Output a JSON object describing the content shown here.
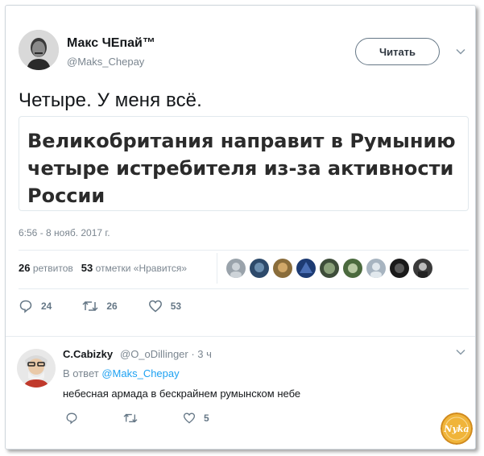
{
  "tweet": {
    "author_name": "Макс ЧЕпай™",
    "author_handle": "@Maks_Chepay",
    "follow_label": "Читать",
    "text": "Четыре. У меня всё.",
    "quote_headline": "Великобритания направит в Румынию четыре истребителя из-за активности России",
    "timestamp": "6:56 - 8 нояб. 2017 г."
  },
  "stats": {
    "retweets_count": "26",
    "retweets_label": "ретвитов",
    "likes_count": "53",
    "likes_label": "отметки «Нравится»"
  },
  "actions": {
    "reply_count": "24",
    "retweet_count": "26",
    "like_count": "53"
  },
  "reply": {
    "author_name": "C.Cabizky",
    "author_handle": "@O_oDillinger",
    "time": "3 ч",
    "in_reply_prefix": "В ответ",
    "in_reply_handle": "@Maks_Chepay",
    "text": "небесная армада в бескрайнем румынском небе",
    "like_count": "5"
  },
  "watermark": {
    "logo_text": "Nyka"
  },
  "colors": {
    "text_primary": "#14171a",
    "text_secondary": "#7b8690",
    "link": "#1da1f2",
    "logo_bg": "#f0b43a"
  },
  "icons": {
    "caret": "chevron-down-icon",
    "reply": "reply-icon",
    "retweet": "retweet-icon",
    "like": "heart-icon"
  }
}
